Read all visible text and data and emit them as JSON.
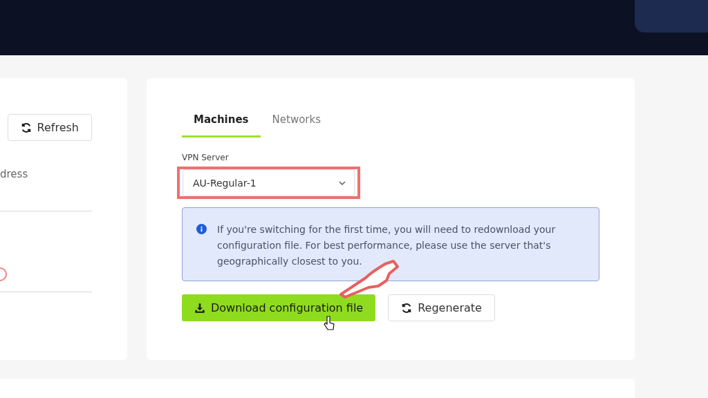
{
  "left_panel": {
    "refresh_button": "Refresh",
    "field_label": "dress"
  },
  "tabs": [
    {
      "label": "Machines",
      "selected": true
    },
    {
      "label": "Networks",
      "selected": false
    }
  ],
  "vpn_server": {
    "label": "VPN Server",
    "value": "AU-Regular-1"
  },
  "notice": "If you're switching for the first time, you will need to redownload your configuration file. For best performance, please use the server that's geographically closest to you.",
  "buttons": [
    {
      "kind": "download",
      "label": "Download configuration file"
    },
    {
      "kind": "regenerate",
      "label": "Regenerate"
    }
  ]
}
